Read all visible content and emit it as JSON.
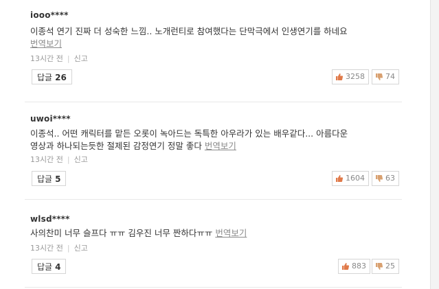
{
  "comments": [
    {
      "user": "iooo****",
      "lines": [
        "이종석 연기 진짜 더 성숙한 느낌.. 노개런티로 참여했다는 단막극에서 인생연기를 하네요"
      ],
      "translate": "번역보기",
      "time": "13시간 전",
      "report": "신고",
      "reply_label": "답글",
      "reply_count": "26",
      "likes": "3258",
      "dislikes": "74"
    },
    {
      "user": "uwoi****",
      "lines": [
        "이종석.. 어떤 캐릭터를 맡든 오롯이 녹아드는 독특한 아우라가 있는 배우같다... 아름다운",
        "영상과 하나되는듯한 절제된 감정연기 정말 좋다"
      ],
      "translate": "번역보기",
      "time": "13시간 전",
      "report": "신고",
      "reply_label": "답글",
      "reply_count": "5",
      "likes": "1604",
      "dislikes": "63"
    },
    {
      "user": "wlsd****",
      "lines": [
        "사의찬미 너무 슬프다 ㅠㅠ 김우진 너무 짠하다ㅠㅠ"
      ],
      "translate": "번역보기",
      "time": "13시간 전",
      "report": "신고",
      "reply_label": "답글",
      "reply_count": "4",
      "likes": "883",
      "dislikes": "25"
    }
  ],
  "colors": {
    "like": "#e07a4a",
    "dislike": "#d8a070"
  },
  "icons": {
    "like": "thumbs-up-icon",
    "dislike": "thumbs-down-icon"
  }
}
